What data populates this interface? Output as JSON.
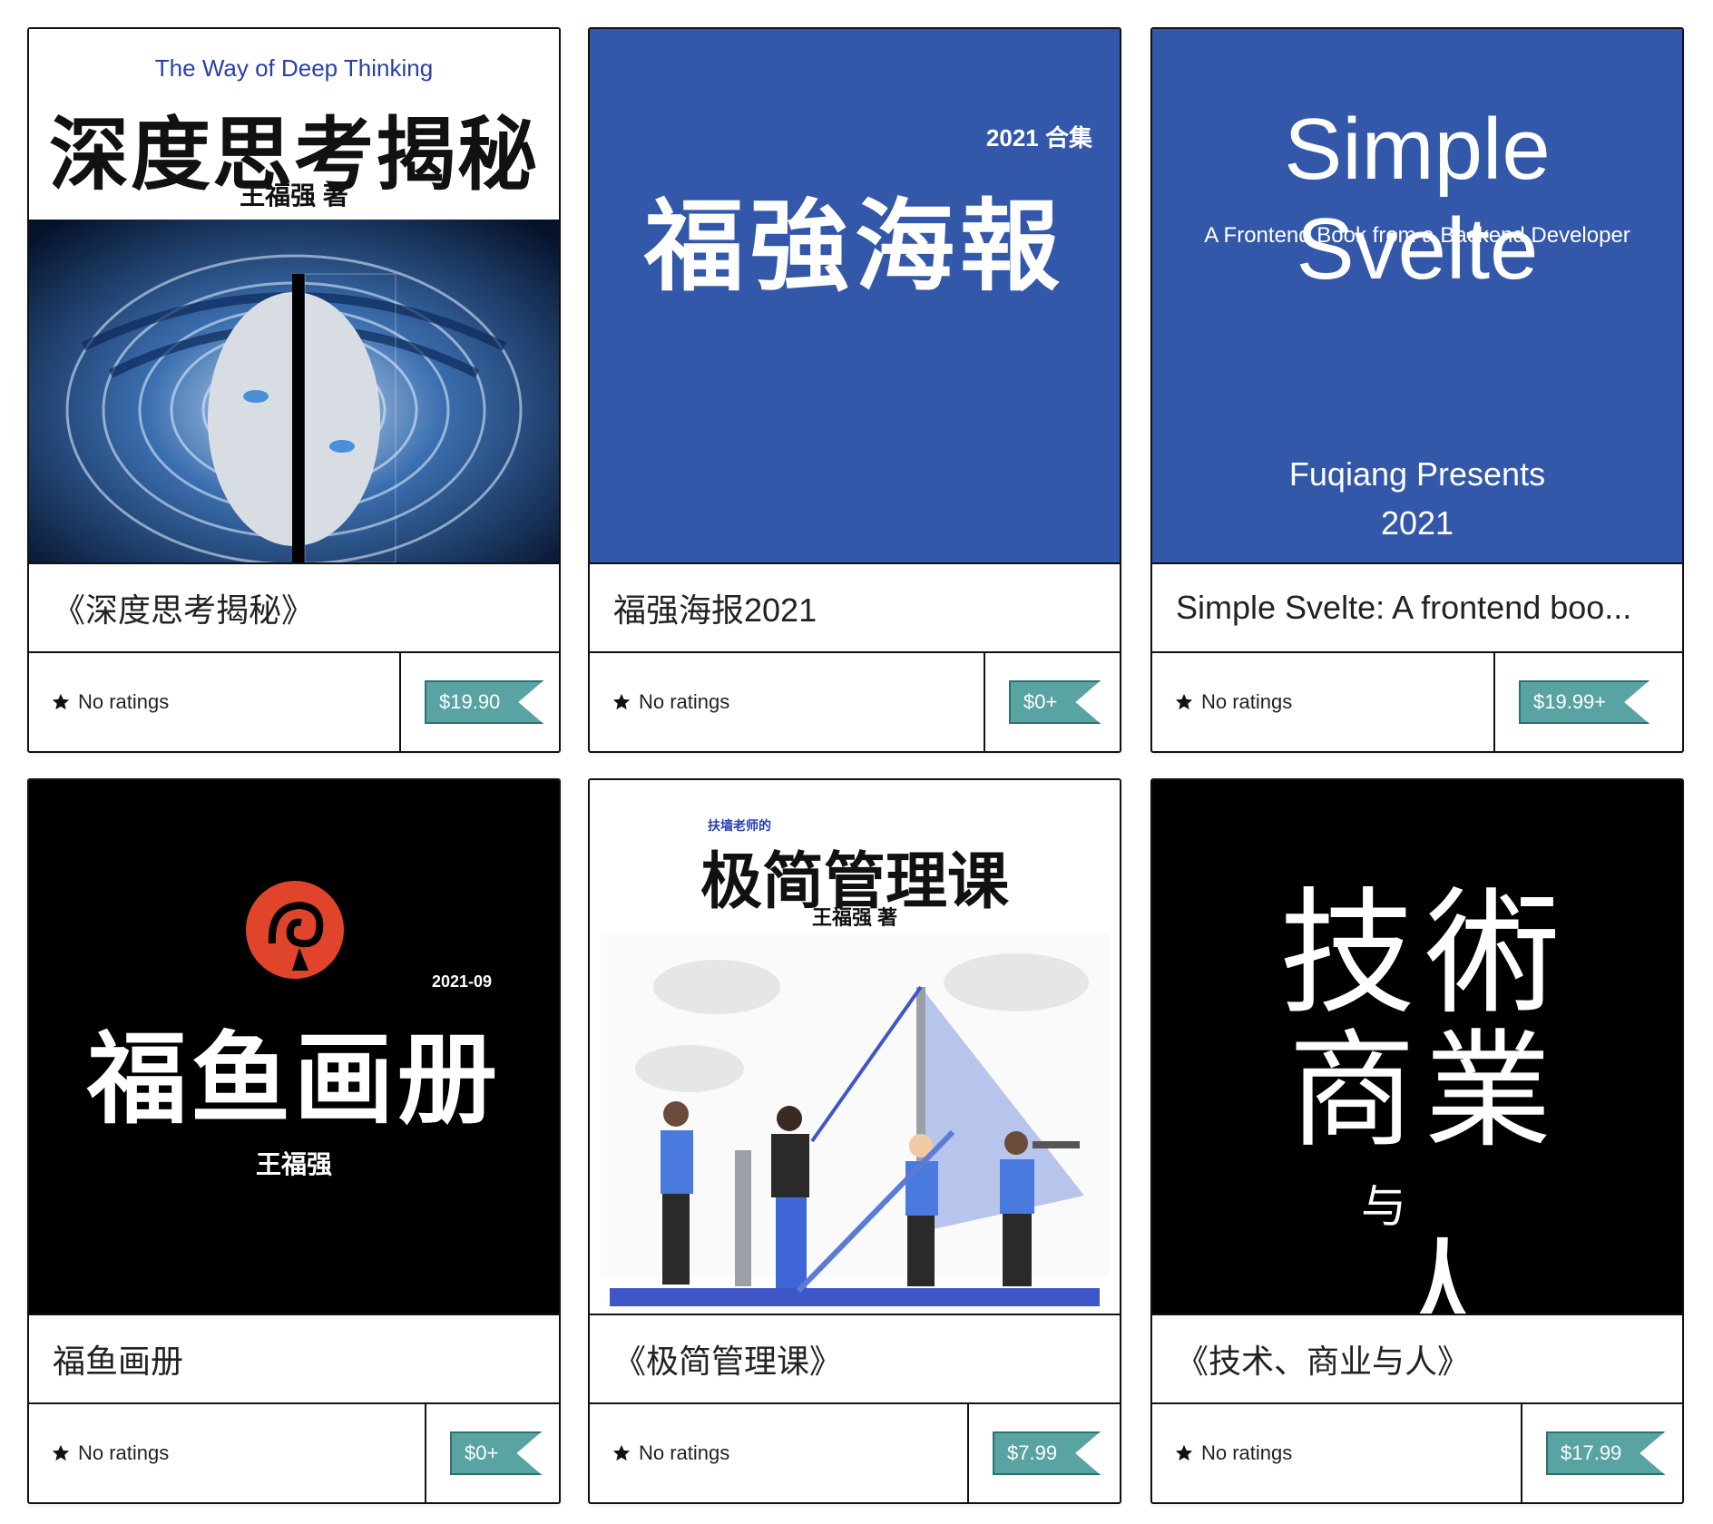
{
  "books": [
    {
      "cover": {
        "subtitle_en": "The Way of Deep Thinking",
        "title_cn": "深度思考揭秘",
        "author": "王福强 著"
      },
      "title": "《深度思考揭秘》",
      "rating": "No ratings",
      "price": "$19.90"
    },
    {
      "cover": {
        "year": "2021 合集",
        "title_cn": "福強海報"
      },
      "title": "福强海报2021",
      "rating": "No ratings",
      "price": "$0+"
    },
    {
      "cover": {
        "title_en": "Simple Svelte",
        "subtitle_en": "A Frontend Book from a Backend Developer",
        "presenter": "Fuqiang Presents",
        "year": "2021"
      },
      "title": "Simple Svelte: A frontend boo...",
      "rating": "No ratings",
      "price": "$19.99+"
    },
    {
      "cover": {
        "date": "2021-09",
        "title_cn": "福鱼画册",
        "author": "王福强"
      },
      "title": "福鱼画册",
      "rating": "No ratings",
      "price": "$0+"
    },
    {
      "cover": {
        "tag": "扶墙老师的",
        "title_cn": "极简管理课",
        "author": "王福强 著"
      },
      "title": "《极简管理课》",
      "rating": "No ratings",
      "price": "$7.99"
    },
    {
      "cover": {
        "line1": "技術",
        "line2": "商業",
        "line3": "与",
        "line4": "人"
      },
      "title": "《技术、商业与人》",
      "rating": "No ratings",
      "price": "$17.99"
    }
  ],
  "colors": {
    "cover_blue": "#3358a9",
    "price_teal": "#5aa3a3",
    "black": "#000000",
    "red_logo": "#e0452b"
  },
  "icons": {
    "star": "star-icon"
  }
}
